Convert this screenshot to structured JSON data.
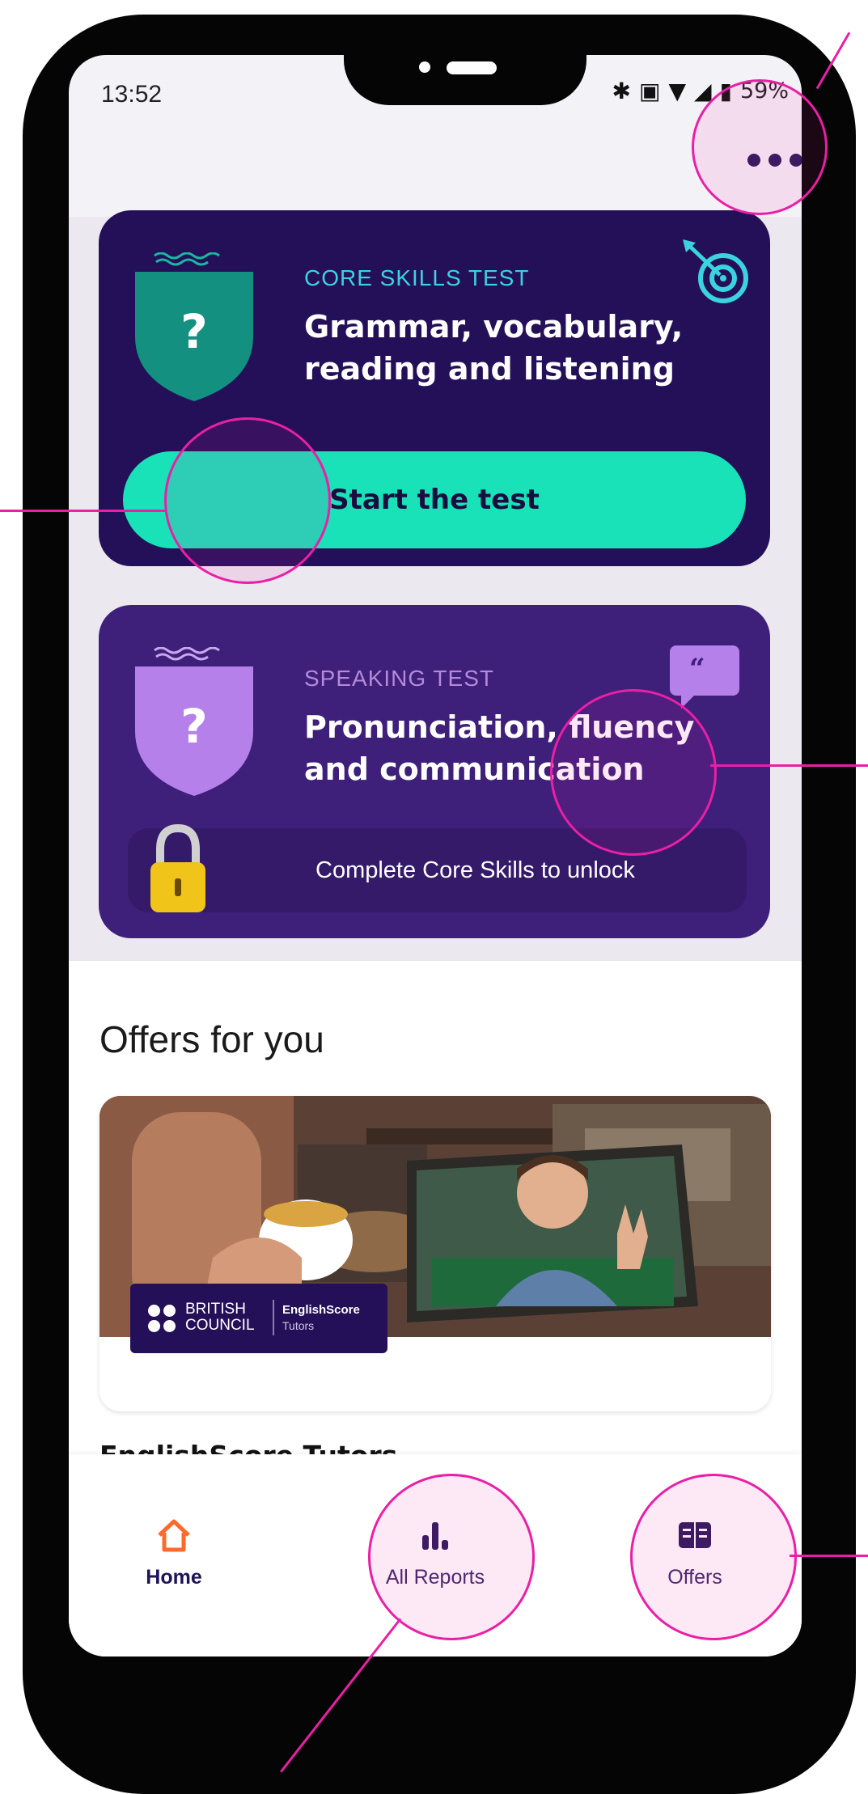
{
  "status_bar": {
    "time": "13:52",
    "battery": "59%",
    "icons": [
      "bluetooth-icon",
      "vibrate-icon",
      "wifi-icon",
      "signal-icon",
      "battery-icon"
    ]
  },
  "header": {
    "more_icon": "more-horizontal-icon"
  },
  "core_card": {
    "eyebrow": "CORE SKILLS TEST",
    "title": "Grammar, vocabulary, reading and listening",
    "button_label": "Start the test",
    "shield_symbol": "?",
    "icon": "target-icon"
  },
  "speaking_card": {
    "eyebrow": "SPEAKING TEST",
    "title": "Pronunciation, fluency and communication",
    "lock_text": "Complete Core Skills to unlock",
    "shield_symbol": "?",
    "icon": "quote-icon"
  },
  "offers": {
    "heading": "Offers for you",
    "card": {
      "title": "EnglishScore Tutors",
      "logo_org": "BRITISH COUNCIL",
      "logo_org_line1": "BRITISH",
      "logo_org_line2": "COUNCIL",
      "logo_product": "EnglishScore",
      "logo_product_sub": "Tutors"
    }
  },
  "bottom_nav": {
    "items": [
      {
        "label": "Home",
        "icon": "home-icon",
        "active": true
      },
      {
        "label": "All Reports",
        "icon": "bar-chart-icon",
        "active": false
      },
      {
        "label": "Offers",
        "icon": "book-open-icon",
        "active": false
      }
    ]
  },
  "colors": {
    "core_card_bg": "#241058",
    "speaking_card_bg": "#3e1f7a",
    "button_bg": "#19e2b8",
    "accent_teal": "#3ad3df",
    "accent_lavender": "#b58ad8",
    "home_active": "#ff6a2b",
    "callout": "#ea1fa6"
  }
}
